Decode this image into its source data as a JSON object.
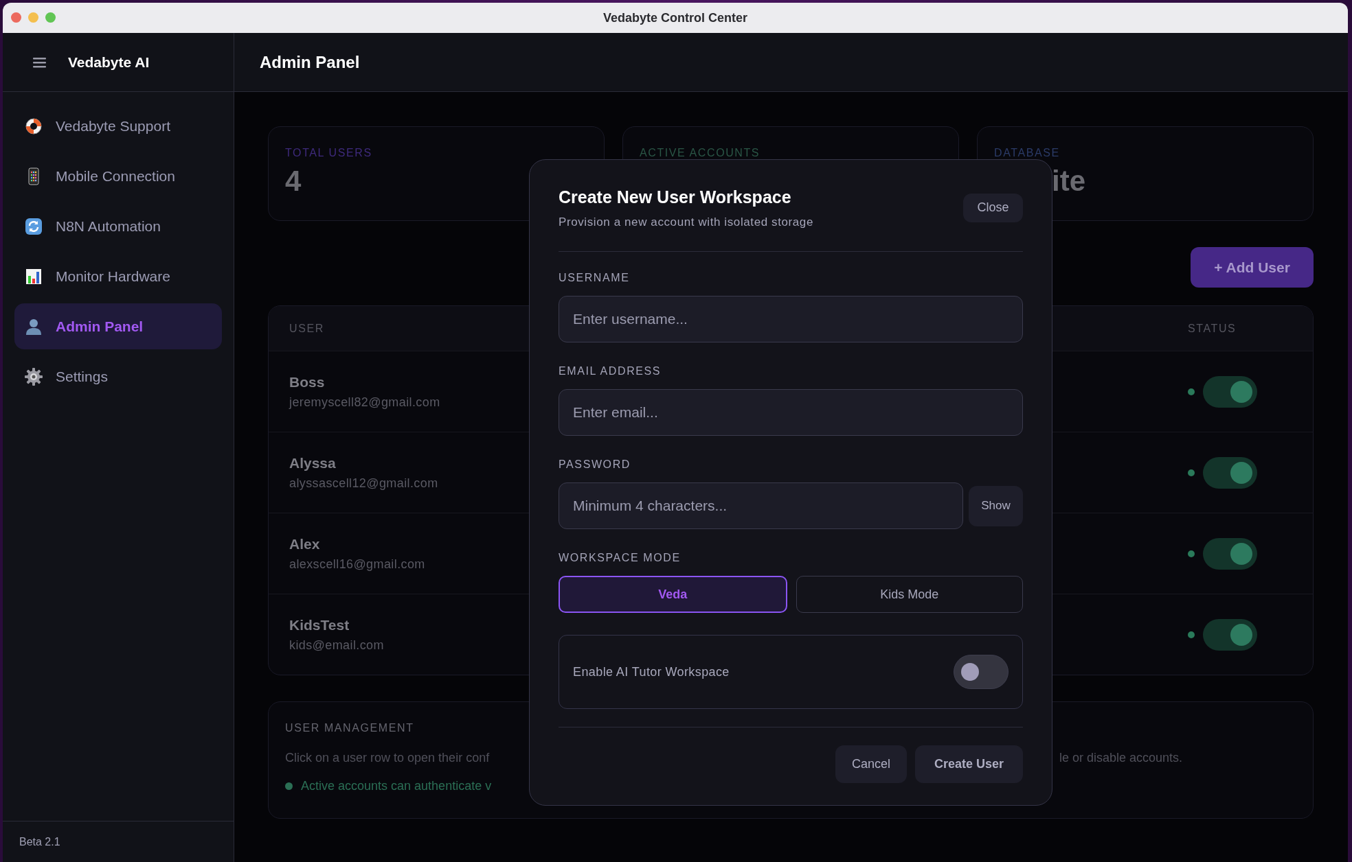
{
  "window": {
    "title": "Vedabyte Control Center"
  },
  "sidebar": {
    "brand": "Vedabyte AI",
    "items": [
      {
        "label": "Vedabyte Support",
        "selected": false
      },
      {
        "label": "Mobile Connection",
        "selected": false
      },
      {
        "label": "N8N Automation",
        "selected": false
      },
      {
        "label": "Monitor Hardware",
        "selected": false
      },
      {
        "label": "Admin Panel",
        "selected": true
      },
      {
        "label": "Settings",
        "selected": false
      }
    ],
    "footer": "Beta 2.1"
  },
  "header": {
    "title": "Admin Panel"
  },
  "stats": [
    {
      "label": "TOTAL USERS",
      "value": "4",
      "color": "#3e2a7c"
    },
    {
      "label": "ACTIVE ACCOUNTS",
      "color": "#2a5646"
    },
    {
      "label": "DATABASE",
      "value": "ite",
      "color": "#2b3b68"
    }
  ],
  "add_button": "+ Add User",
  "table": {
    "columns": [
      "USER",
      "STATUS"
    ],
    "rows": [
      {
        "name": "Boss",
        "email": "jeremyscell82@gmail.com",
        "active": true
      },
      {
        "name": "Alyssa",
        "email": "alyssascell12@gmail.com",
        "active": true
      },
      {
        "name": "Alex",
        "email": "alexscell16@gmail.com",
        "active": true
      },
      {
        "name": "KidsTest",
        "email": "kids@email.com",
        "active": true
      }
    ]
  },
  "info": {
    "title": "USER MANAGEMENT",
    "text_left": "Click on a user row to open their conf",
    "text_right": "le or disable accounts.",
    "note": "Active accounts can authenticate v"
  },
  "modal": {
    "title": "Create New User Workspace",
    "subtitle": "Provision a new account with isolated storage",
    "close": "Close",
    "fields": [
      {
        "label": "USERNAME",
        "placeholder": "Enter username..."
      },
      {
        "label": "EMAIL ADDRESS",
        "placeholder": "Enter email..."
      },
      {
        "label": "PASSWORD",
        "placeholder": "Minimum 4 characters...",
        "action": "Show"
      }
    ],
    "mode_label": "WORKSPACE MODE",
    "modes": [
      {
        "label": "Veda",
        "selected": true
      },
      {
        "label": "Kids Mode",
        "selected": false
      }
    ],
    "option": {
      "label": "Enable AI Tutor Workspace",
      "on": false
    },
    "buttons": [
      "Cancel",
      "Create User"
    ]
  }
}
